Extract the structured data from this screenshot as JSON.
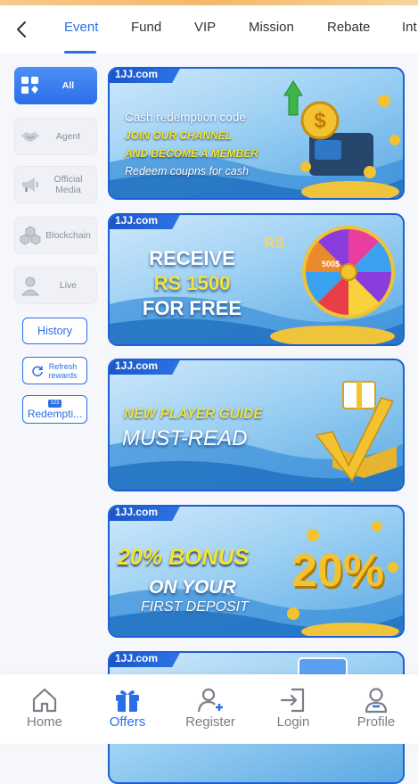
{
  "tabs": [
    "Event",
    "Fund",
    "VIP",
    "Mission",
    "Rebate",
    "Int"
  ],
  "active_tab": "Event",
  "sidebar": {
    "categories": [
      {
        "label": "All",
        "icon": "grid-icon",
        "active": true
      },
      {
        "label": "Agent",
        "icon": "handshake-icon",
        "active": false
      },
      {
        "label": "Official Media",
        "icon": "megaphone-icon",
        "active": false
      },
      {
        "label": "Blockchain",
        "icon": "cubes-icon",
        "active": false
      },
      {
        "label": "Live",
        "icon": "person-icon",
        "active": false
      }
    ],
    "history_label": "History",
    "refresh_label": "Refresh rewards",
    "redemption_label": "Redempti...",
    "redemption_badge": "123"
  },
  "banners": [
    {
      "tag": "1JJ.com",
      "lines": [
        "Cash redemption code",
        "JOIN OUR CHANNEL",
        "AND BECOME A MEMBER",
        "Redeem coupns for cash"
      ]
    },
    {
      "tag": "1JJ.com",
      "lines": [
        "RECEIVE",
        "RS 1500",
        "FOR FREE"
      ],
      "wheel_currency": "RS",
      "wheel_value": "500$"
    },
    {
      "tag": "1JJ.com",
      "lines": [
        "NEW PLAYER GUIDE",
        "MUST-READ"
      ]
    },
    {
      "tag": "1JJ.com",
      "lines": [
        "20% BONUS",
        "ON YOUR",
        "FIRST DEPOSIT"
      ],
      "big_number": "20%"
    },
    {
      "tag": "1JJ.com",
      "lines": []
    }
  ],
  "bottom_nav": [
    {
      "label": "Home",
      "icon": "home-icon",
      "active": false
    },
    {
      "label": "Offers",
      "icon": "gift-icon",
      "active": true
    },
    {
      "label": "Register",
      "icon": "add-user-icon",
      "active": false
    },
    {
      "label": "Login",
      "icon": "login-icon",
      "active": false
    },
    {
      "label": "Profile",
      "icon": "profile-icon",
      "active": false
    }
  ],
  "colors": {
    "accent": "#2a6fe8",
    "banner_border": "#1d5fd6",
    "gold": "#f2c230",
    "muted": "#8b8f98"
  }
}
